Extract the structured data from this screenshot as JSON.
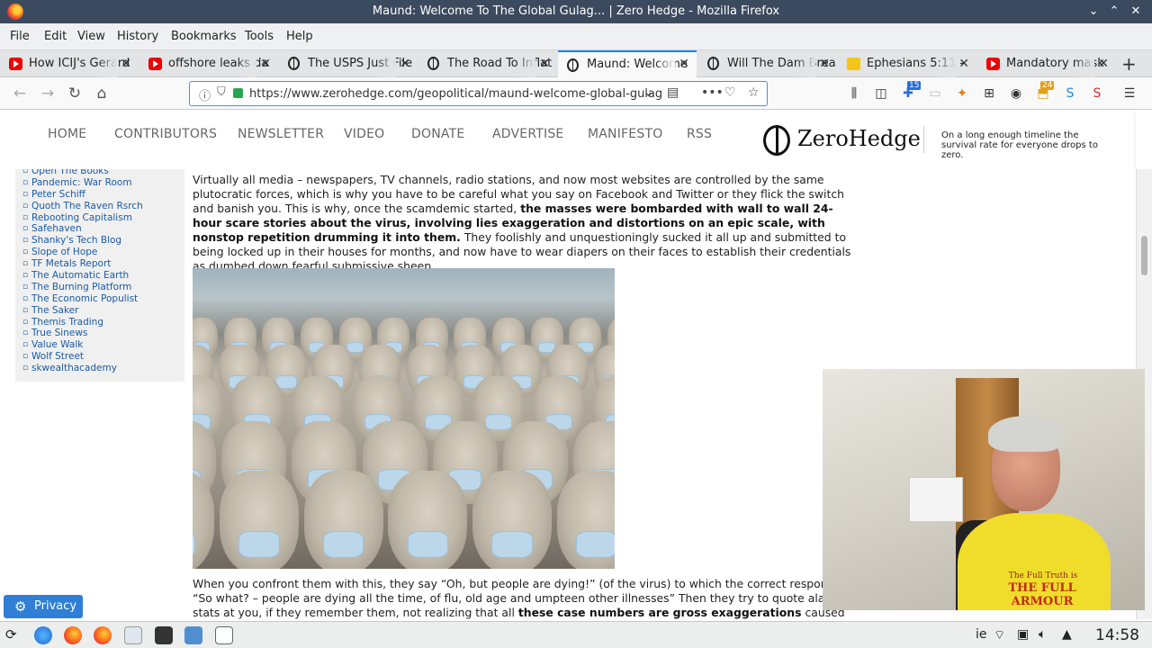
{
  "window": {
    "title": "Maund: Welcome To The Global Gulag... | Zero Hedge - Mozilla Firefox"
  },
  "menubar": [
    "File",
    "Edit",
    "View",
    "History",
    "Bookmarks",
    "Tools",
    "Help"
  ],
  "tabs": [
    {
      "label": "How ICIJ's Gerard",
      "icon": "youtube-icon"
    },
    {
      "label": "offshore leaks da",
      "icon": "youtube-icon"
    },
    {
      "label": "The USPS Just File",
      "icon": "zerohedge-icon"
    },
    {
      "label": "The Road To Inflat",
      "icon": "zerohedge-icon"
    },
    {
      "label": "Maund: Welcome",
      "icon": "zerohedge-icon",
      "active": true
    },
    {
      "label": "Will The Dam Brea",
      "icon": "zerohedge-icon"
    },
    {
      "label": "Ephesians 5:11 - ",
      "icon": "bible-icon"
    },
    {
      "label": "Mandatory mask",
      "icon": "youtube-icon"
    }
  ],
  "url": "https://www.zerohedge.com/geopolitical/maund-welcome-global-gulag",
  "badges": {
    "pocket": "15",
    "ext": "24"
  },
  "site": {
    "nav": [
      "HOME",
      "CONTRIBUTORS",
      "NEWSLETTER",
      "VIDEO",
      "DONATE",
      "ADVERTISE",
      "MANIFESTO",
      "RSS"
    ],
    "logo": "ZeroHedge",
    "tagline": "On a long enough timeline the survival rate for everyone drops to zero."
  },
  "sidebar": [
    "Open The Books",
    "Pandemic: War Room",
    "Peter Schiff",
    "Quoth The Raven Rsrch",
    "Rebooting Capitalism",
    "Safehaven",
    "Shanky's Tech Blog",
    "Slope of Hope",
    "TF Metals Report",
    "The Automatic Earth",
    "The Burning Platform",
    "The Economic Populist",
    "The Saker",
    "Themis Trading",
    "True Sinews",
    "Value Walk",
    "Wolf Street",
    "skwealthacademy"
  ],
  "article": {
    "p1_a": "Virtually all media – newspapers, TV channels, radio stations, and now most websites are controlled by the same plutocratic forces, which is why you have to be careful what you say on Facebook and Twitter or they flick the switch and banish you. This is why, once the scamdemic started, ",
    "p1_b": "the masses were bombarded with wall to wall 24-hour scare stories about the virus, involving lies exaggeration and distortions on an epic scale, with nonstop repetition drumming it into them.",
    "p1_c": " They foolishly and unquestioningly sucked it all up and submitted to being locked up in their houses for months, and now have to wear diapers on their faces to establish their credentials as dumbed down fearful submissive sheep.",
    "p2_a": "When you confront them with this, they say “Oh, but people are dying!” (of the virus) to which the correct response is “So what? – people are dying all the time, of flu, old age and umpteen other illnesses” Then they try to quote alarming stats at you, if they remember them, not realizing that all ",
    "p2_b": "these case numbers are gross exaggerations",
    "p2_c": " caused by phony test"
  },
  "webcam": {
    "shirt_line1": "The Full Truth is",
    "shirt_line2": "THE FULL ARMOUR"
  },
  "privacy_label": "Privacy",
  "taskbar": {
    "lang": "ie",
    "clock": "14:58"
  }
}
